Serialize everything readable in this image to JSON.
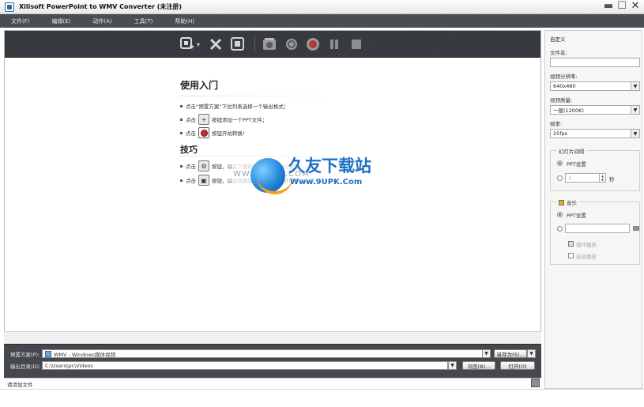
{
  "window": {
    "title": "Xilisoft PowerPoint to WMV Converter (未注册)",
    "minimize": "▬",
    "maximize": "☐",
    "close": "✕"
  },
  "menu": [
    "文件(F)",
    "编辑(E)",
    "动作(A)",
    "工具(T)",
    "帮助(H)"
  ],
  "toolbar": {
    "icons": [
      "add-ppt-icon",
      "dropdown-arrow-icon",
      "remove-icon",
      "properties-icon",
      "snapshot-icon",
      "settings-icon",
      "record-icon",
      "pause-icon",
      "stop-icon"
    ],
    "accent": "#3a3d42"
  },
  "getting_started": {
    "heading": "使用入门",
    "line1": "点击“预置方案”下拉列表选择一个输出格式；",
    "line2_pre": "点击",
    "line2_post": "按钮添加一个PPT文件；",
    "line3_pre": "点击",
    "line3_post": "按钮开始转换!"
  },
  "tips": {
    "heading": "技巧",
    "line1_pre": "点击",
    "line1_post": "按钮，以",
    "line1_faded": "在下面的设置面板中进行设置",
    "line2_pre": "点击",
    "line2_post": "按钮，以",
    "line2_faded": "在转换前对所选幻灯片进行预览截图"
  },
  "watermark": {
    "small": "WWW.9UPK.COM",
    "title": "久友下载站",
    "url": "Www.9UPK.Com"
  },
  "bottom": {
    "profile_label": "预置方案(P):",
    "profile_value": "WMV - Windows媒体视频",
    "save_as": "另存为(S)...",
    "output_label": "输出目录(D):",
    "output_value": "C:\\Users\\pc\\Videos",
    "browse": "浏览(B)...",
    "open": "打开(O)",
    "status": "请添加文件"
  },
  "panel": {
    "title": "自定义",
    "filename_label": "文件名:",
    "filename_value": "",
    "resolution_label": "视频分辨率:",
    "resolution_value": "640x480",
    "quality_label": "视频质量:",
    "quality_value": "一般(1200K)",
    "framerate_label": "帧率:",
    "framerate_value": "25fps",
    "interval_legend": "幻灯片间隔",
    "interval_opt1": "PPT设置",
    "interval_value": "2",
    "interval_unit": "秒",
    "music_legend": "音乐",
    "music_opt1": "PPT设置",
    "music_path": "",
    "loop_label": "循环播放",
    "extend_label": "延展播放"
  }
}
